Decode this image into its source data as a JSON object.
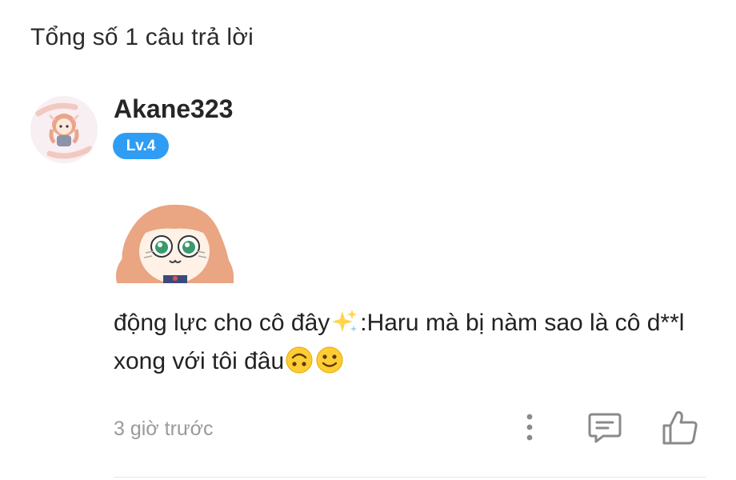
{
  "header": {
    "title": "Tổng số 1 câu trả lời"
  },
  "comment": {
    "author": "Akane323",
    "level": "Lv.4",
    "avatar_icon": "anime-girl-avatar",
    "sticker_icon": "anime-girl-sticker",
    "text_part1": "động lực cho cô đây",
    "emoji1": "sparkles",
    "text_part2": ":Haru mà bị nàm sao là cô d**l xong với tôi đâu",
    "emoji2": "upside-down-face",
    "emoji3": "slightly-smiling-face",
    "timestamp": "3 giờ trước",
    "actions": {
      "more_icon": "more-vertical-icon",
      "reply_icon": "comment-icon",
      "like_icon": "thumbs-up-icon"
    }
  },
  "colors": {
    "badge": "#2f9df4",
    "muted": "#9a9a9a",
    "text": "#222222"
  }
}
